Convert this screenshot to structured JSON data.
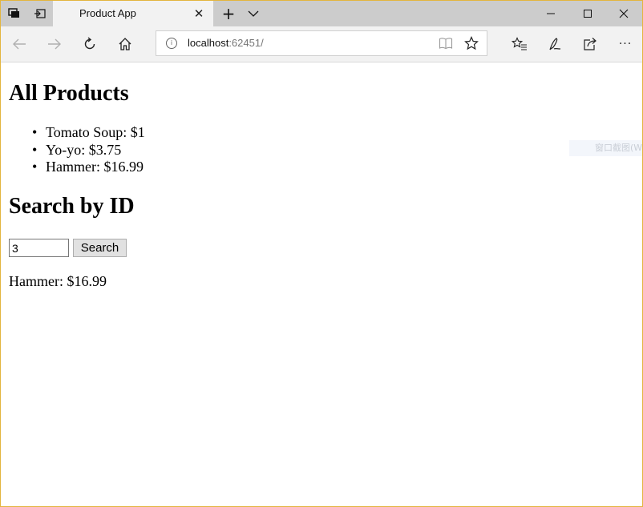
{
  "browser": {
    "tab": {
      "title": "Product App"
    },
    "address": {
      "host": "localhost",
      "rest": ":62451/"
    }
  },
  "page": {
    "all_products_heading": "All Products",
    "products": [
      "Tomato Soup: $1",
      "Yo-yo: $3.75",
      "Hammer: $16.99"
    ],
    "search_heading": "Search by ID",
    "search": {
      "value": "3",
      "button_label": "Search"
    },
    "result": "Hammer: $16.99"
  },
  "overlay": {
    "text": "窗口截图(W)"
  },
  "icons": {
    "tab_actions": "tab-actions-icon",
    "set_aside_tabs": "set-aside-tabs-icon",
    "new_tab": "plus-icon",
    "tab_list": "chevron-down-icon",
    "minimize": "minimize-icon",
    "maximize": "maximize-icon",
    "close": "close-icon",
    "back": "back-arrow-icon",
    "forward": "forward-arrow-icon",
    "refresh": "refresh-icon",
    "home": "home-icon",
    "site_info": "info-icon",
    "reading_view": "book-icon",
    "favorite": "star-icon",
    "favorites_hub": "favorites-list-icon",
    "notes": "pen-icon",
    "share": "share-icon",
    "more": "more-icon"
  },
  "colors": {
    "tabstrip": "#cccccc",
    "toolbar": "#f2f2f2",
    "window_border": "#e3b53f",
    "url_rest": "#767676"
  }
}
